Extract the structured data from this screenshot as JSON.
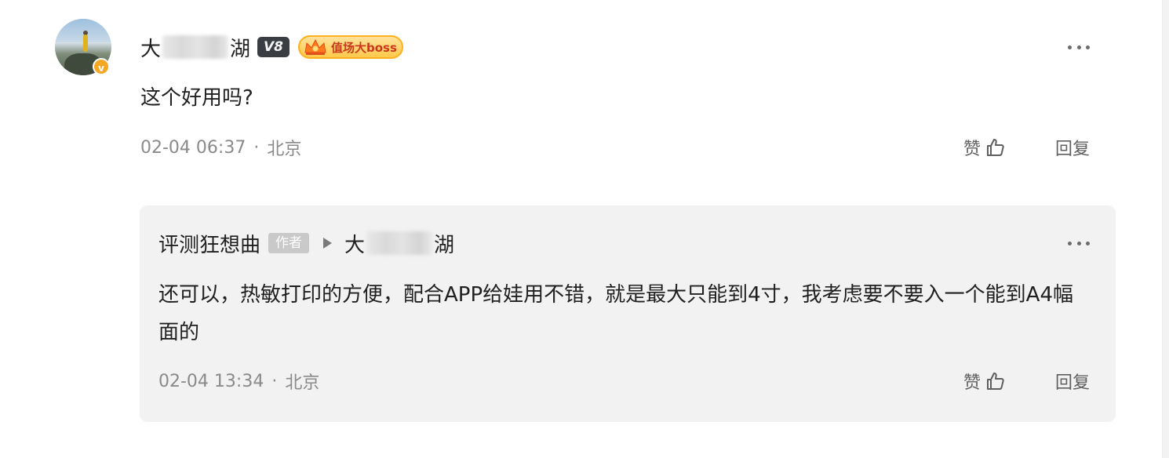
{
  "comment": {
    "username_prefix": "大",
    "username_suffix": "湖",
    "verified_icon": "v",
    "vip_level": "V8",
    "badge_label": "值场大boss",
    "text": "这个好用吗?",
    "time": "02-04 06:37",
    "dot": "·",
    "location": "北京",
    "like_label": "赞",
    "reply_label": "回复"
  },
  "reply": {
    "author": "评测狂想曲",
    "author_tag": "作者",
    "target_prefix": "大",
    "target_suffix": "湖",
    "text": "还可以，热敏打印的方便，配合APP给娃用不错，就是最大只能到4寸，我考虑要不要入一个能到A4幅面的",
    "time": "02-04 13:34",
    "dot": "·",
    "location": "北京",
    "like_label": "赞",
    "reply_label": "回复"
  },
  "colors": {
    "badge_gold": "#ffc94a",
    "vip_dark": "#3a3d42",
    "reply_bg": "#f2f2f2"
  }
}
